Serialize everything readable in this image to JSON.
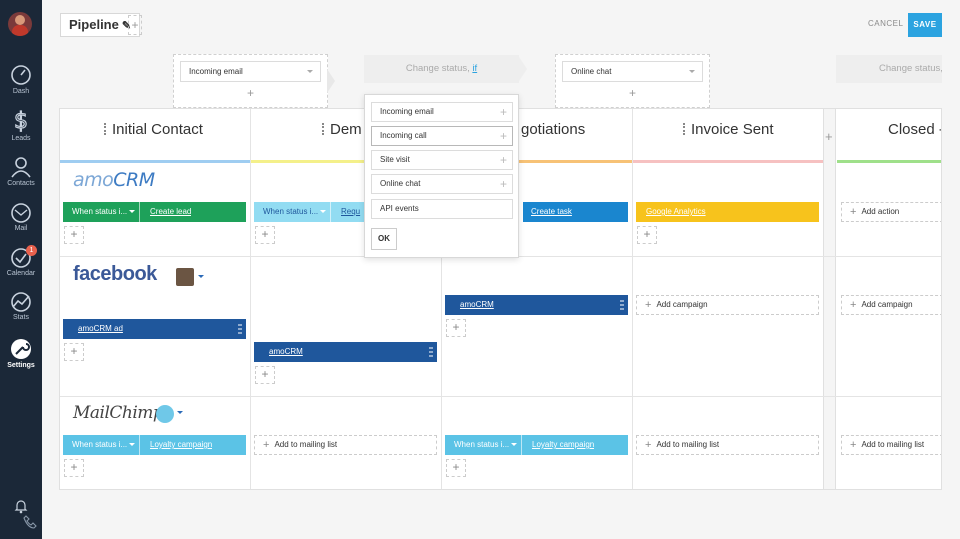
{
  "sidebar": {
    "items": [
      {
        "label": "Dash",
        "icon": "dashboard-icon"
      },
      {
        "label": "Leads",
        "icon": "dollar-icon"
      },
      {
        "label": "Contacts",
        "icon": "contacts-icon"
      },
      {
        "label": "Mail",
        "icon": "mail-icon"
      },
      {
        "label": "Calendar",
        "icon": "calendar-icon",
        "badge": "1"
      },
      {
        "label": "Stats",
        "icon": "stats-icon"
      },
      {
        "label": "Settings",
        "icon": "settings-icon"
      }
    ]
  },
  "header": {
    "pipeline_name": "Pipeline",
    "add_label": "+",
    "cancel_label": "CANCEL",
    "save_label": "SAVE"
  },
  "triggers": {
    "t1": "Incoming email",
    "t2_text": "Change status,",
    "t2_link": "if",
    "t3": "Online chat",
    "t4_text": "Change status,",
    "plus": "+"
  },
  "columns": [
    {
      "title": "Initial Contact",
      "color": "#9fcdf1"
    },
    {
      "title": "Demo",
      "color": "#f4f08a"
    },
    {
      "title": "Negotiations",
      "color": "#f7c276"
    },
    {
      "title": "Invoice Sent",
      "color": "#f6c1c1"
    },
    {
      "title": "Closed -",
      "color": "#9fe08a"
    }
  ],
  "visible_titles": {
    "demo": "Dem",
    "neg": "gotiations"
  },
  "rows": {
    "amo": {
      "logo_a": "amo",
      "logo_b": "CRM",
      "c1_cond": "When status i...",
      "c1_act": "Create lead",
      "c2_cond": "When status i...",
      "c2_act": "Requ",
      "c3_act": "Create task",
      "c4_act": "Google Analytics",
      "c5_add": "Add action"
    },
    "fb": {
      "logo": "facebook",
      "c1_act": "amoCRM ad",
      "c2_act": "amoCRM",
      "c3_act": "amoCRM",
      "c4_add": "Add campaign",
      "c5_add": "Add campaign"
    },
    "mc": {
      "logo": "MailChimp",
      "c1_cond": "When status i...",
      "c1_act": "Loyalty campaign",
      "c2_add": "Add to mailing list",
      "c3_cond": "When status i...",
      "c3_act": "Loyalty campaign",
      "c4_add": "Add to mailing list",
      "c5_add": "Add to mailing list"
    }
  },
  "popup": {
    "options": [
      "Incoming email",
      "Incoming call",
      "Site visit",
      "Online chat",
      "API events"
    ],
    "ok_label": "OK"
  },
  "colors": {
    "green": "#1ea15a",
    "lightblue": "#5bc3e6",
    "darkblue": "#1f579c",
    "blue": "#1a86cf",
    "yellow": "#f7c31c",
    "sidebar": "#1b2838",
    "accent": "#2ba3e0"
  }
}
